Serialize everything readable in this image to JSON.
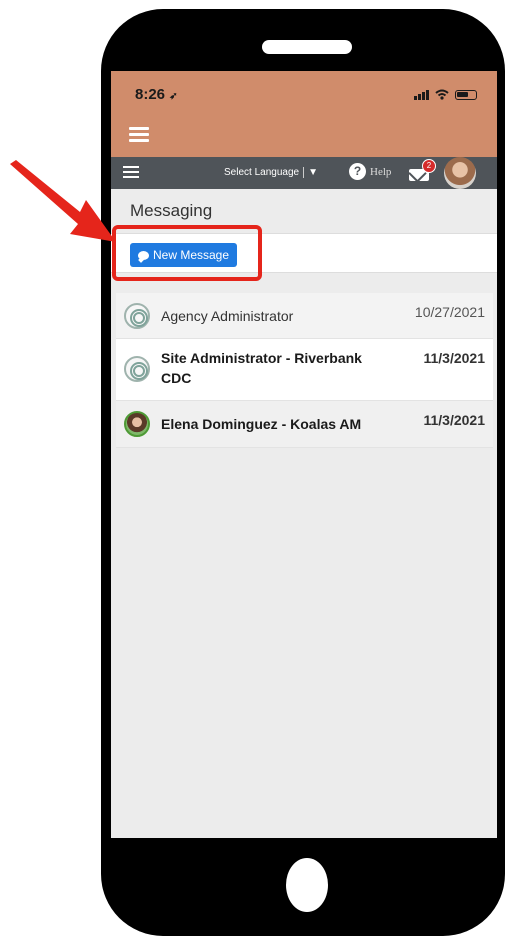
{
  "status_bar": {
    "time": "8:26",
    "icons": [
      "location-arrow-icon",
      "signal-icon",
      "wifi-icon",
      "battery-icon"
    ]
  },
  "top_nav": {
    "language_label": "Select Language",
    "language_caret": "▼",
    "help_label": "Help",
    "help_glyph": "?",
    "mail_badge_count": "2",
    "icons": [
      "menu-icon",
      "help-icon",
      "mail-icon",
      "user-avatar"
    ]
  },
  "page": {
    "title": "Messaging",
    "new_message_label": "New Message"
  },
  "messages": [
    {
      "sender": "Agency Administrator",
      "date": "10/27/2021",
      "unread": false,
      "avatar": "agency-logo-icon"
    },
    {
      "sender": "Site Administrator - Riverbank CDC",
      "date": "11/3/2021",
      "unread": true,
      "avatar": "agency-logo-icon"
    },
    {
      "sender": "Elena Dominguez - Koalas AM",
      "date": "11/3/2021",
      "unread": true,
      "avatar": "user-photo"
    }
  ],
  "colors": {
    "status_bar": "#d08c6b",
    "nav_bar": "#4f5459",
    "primary_button": "#1f7ae0",
    "annotation_red": "#e5251b"
  }
}
